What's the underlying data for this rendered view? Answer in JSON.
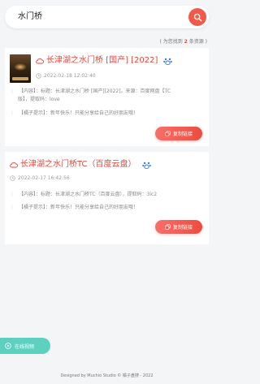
{
  "search": {
    "query": "水门桥"
  },
  "result_summary": {
    "prefix": "( 为您找到 ",
    "count": "2",
    "suffix": " 条资源 )"
  },
  "results": [
    {
      "title": "长津湖之水门桥 [国产] [2022]",
      "time": "2022-02-18 12:02:40",
      "info_line1": "【内容】：标题：长津湖之水门桥 [国产][2022]。来源：百度网盘【TC",
      "info_line2": "版】，提取码：love",
      "tip": "【橘子提示】：新年快乐！只能分享给自己的好朋友哦！",
      "copy_label": "复制链接"
    },
    {
      "title": "长津湖之水门桥TC（百度云盘）",
      "time": "2022-02-17 16:42:56",
      "info_line1": "【内容】：标题：长津湖之水门桥TC（百度云盘），提取码：3ic2",
      "tip": "【橘子提示】：新年快乐！只能分享给自己的好朋友哦！",
      "copy_label": "复制链接"
    }
  ],
  "online_button": {
    "label": "在线视频"
  },
  "footer": {
    "text": "Designed by Muchio Studio © 橘子盘搜 - 2022"
  },
  "colors": {
    "accent": "#e8463a",
    "online": "#5ed0c0",
    "background": "#f4f5f7"
  },
  "icons": [
    "search-icon",
    "cloud-icon",
    "baidu-paw-icon",
    "clock-icon",
    "copy-icon",
    "play-icon"
  ]
}
